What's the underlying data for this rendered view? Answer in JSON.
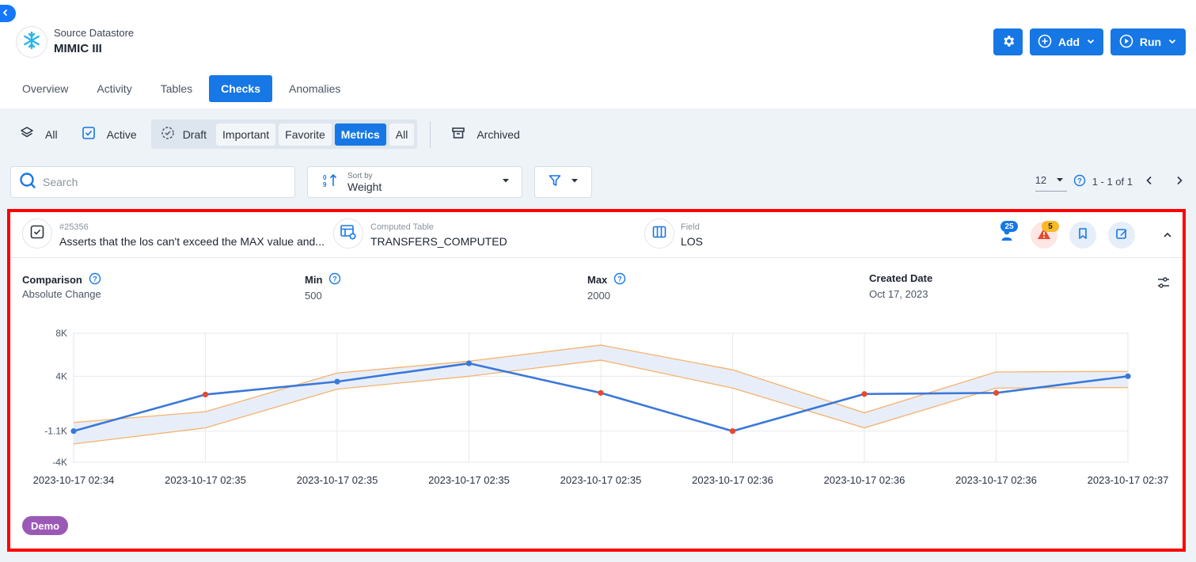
{
  "header": {
    "datastore_caption": "Source Datastore",
    "datastore_name": "MIMIC III",
    "add_label": "Add",
    "run_label": "Run"
  },
  "tabs": [
    {
      "label": "Overview"
    },
    {
      "label": "Activity"
    },
    {
      "label": "Tables"
    },
    {
      "label": "Checks",
      "active": true
    },
    {
      "label": "Anomalies"
    }
  ],
  "filters": {
    "all_label": "All",
    "active_label": "Active",
    "draft_label": "Draft",
    "important_label": "Important",
    "favorite_label": "Favorite",
    "metrics_label": "Metrics",
    "all_sub_label": "All",
    "archived_label": "Archived"
  },
  "search": {
    "placeholder": "Search"
  },
  "sort": {
    "caption": "Sort by",
    "value": "Weight"
  },
  "pagination": {
    "per_page": "12",
    "range": "1 - 1 of 1"
  },
  "check": {
    "id": "#25356",
    "description": "Asserts that the los can't exceed the MAX value and...",
    "table_caption": "Computed Table",
    "table_name": "TRANSFERS_COMPUTED",
    "field_caption": "Field",
    "field_name": "LOS",
    "active_count": "25",
    "anomaly_count": "5",
    "comparison_label": "Comparison",
    "comparison_value": "Absolute Change",
    "min_label": "Min",
    "min_value": "500",
    "max_label": "Max",
    "max_value": "2000",
    "created_label": "Created Date",
    "created_value": "Oct 17, 2023",
    "tag": "Demo"
  },
  "colors": {
    "accent": "#1677e5",
    "line": "#3a78d8",
    "anomaly_point": "#e8492d",
    "band_edge": "#f5b26b",
    "band_fill": "#e8eef9",
    "tag": "#9b59b6",
    "highlight_border": "#ff0000"
  },
  "chart_data": {
    "type": "line",
    "x": [
      "2023-10-17 02:34",
      "2023-10-17 02:35",
      "2023-10-17 02:35",
      "2023-10-17 02:35",
      "2023-10-17 02:35",
      "2023-10-17 02:36",
      "2023-10-17 02:36",
      "2023-10-17 02:36",
      "2023-10-17 02:37"
    ],
    "y_ticks": [
      {
        "value": 8000,
        "label": "8K"
      },
      {
        "value": 4000,
        "label": "4K"
      },
      {
        "value": -1100,
        "label": "-1.1K"
      },
      {
        "value": -4000,
        "label": "-4K"
      }
    ],
    "ylim": [
      -4000,
      8000
    ],
    "series": [
      {
        "values": [
          -1100,
          2300,
          3500,
          5200,
          2450,
          -1100,
          2350,
          2450,
          4000
        ],
        "anomalies": [
          false,
          true,
          false,
          false,
          true,
          true,
          true,
          true,
          false
        ]
      }
    ],
    "band_upper": [
      -300,
      700,
      4300,
      5400,
      6900,
      4600,
      600,
      4400,
      4450
    ],
    "band_lower": [
      -2300,
      -800,
      2800,
      4000,
      5500,
      2900,
      -800,
      2900,
      2950
    ],
    "grid": true
  }
}
